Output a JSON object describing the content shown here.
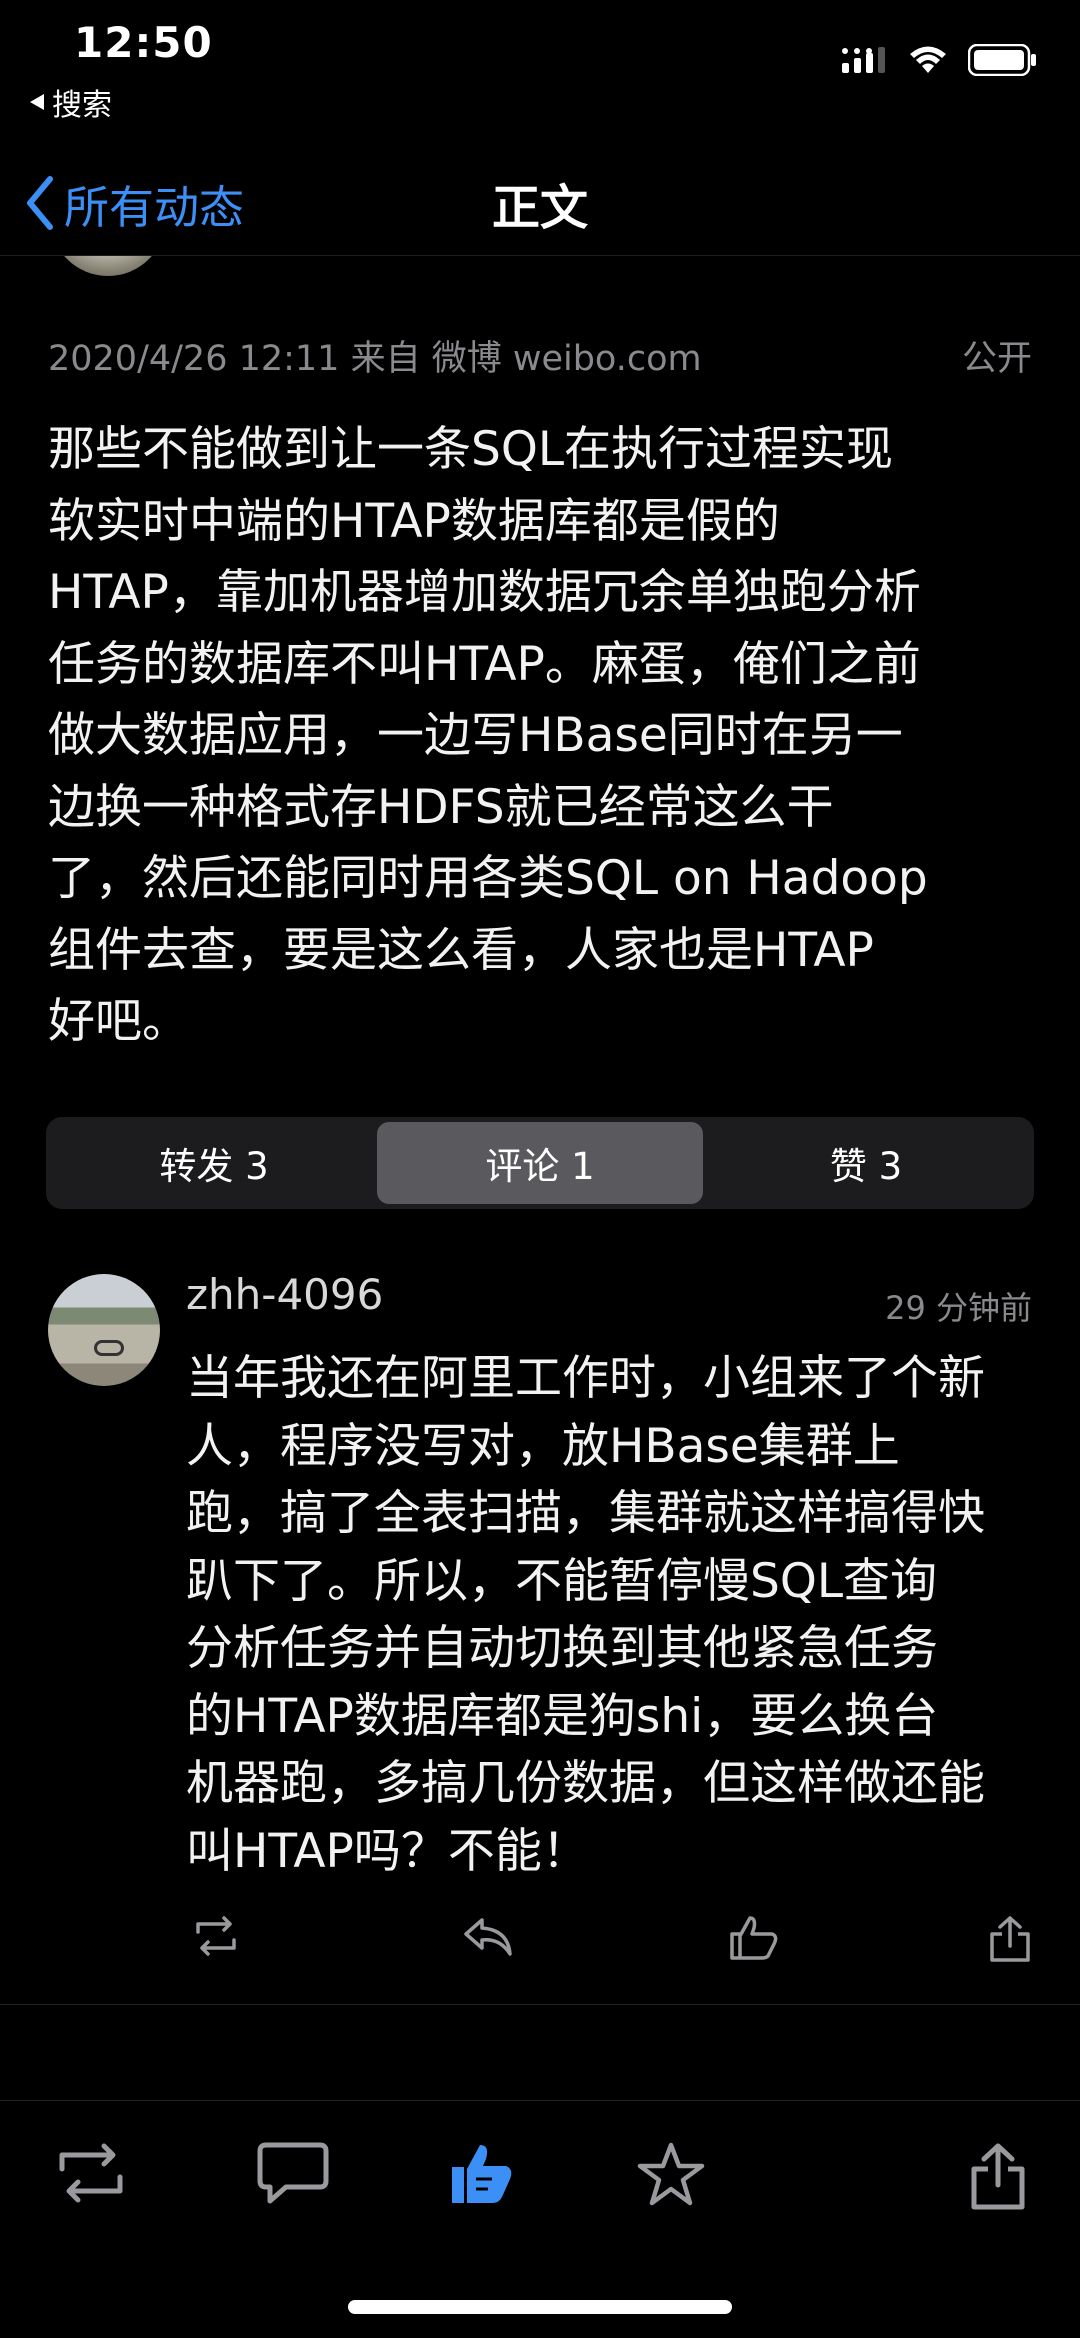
{
  "status": {
    "time": "12:50",
    "back_app": "搜索"
  },
  "nav": {
    "back_label": "所有动态",
    "title": "正文"
  },
  "post": {
    "meta_left": "2020/4/26 12:11 来自 微博 weibo.com",
    "visibility": "公开",
    "body": "那些不能做到让一条SQL在执行过程实现\n软实时中端的HTAP数据库都是假的\nHTAP，靠加机器增加数据冗余单独跑分析\n任务的数据库不叫HTAP。麻蛋，俺们之前\n做大数据应用，一边写HBase同时在另一\n边换一种格式存HDFS就已经常这么干\n了，然后还能同时用各类SQL on Hadoop\n组件去查，要是这么看，人家也是HTAP\n好吧。"
  },
  "tabs": [
    {
      "label": "转发 3",
      "active": false
    },
    {
      "label": "评论 1",
      "active": true
    },
    {
      "label": "赞 3",
      "active": false
    }
  ],
  "comment": {
    "user": "zhh-4096",
    "time": "29 分钟前",
    "text": "当年我还在阿里工作时，小组来了个新\n人，程序没写对，放HBase集群上\n跑，搞了全表扫描，集群就这样搞得快\n趴下了。所以，不能暂停慢SQL查询\n分析任务并自动切换到其他紧急任务\n的HTAP数据库都是狗shi，要么换台\n机器跑，多搞几份数据，但这样做还能\n叫HTAP吗？不能！"
  },
  "icons": {
    "comment_actions": [
      "repost-icon",
      "reply-icon",
      "like-icon",
      "share-icon"
    ],
    "bottom_bar": [
      "repost-icon",
      "comment-icon",
      "like-filled-icon",
      "favorite-icon",
      "share-icon"
    ]
  },
  "colors": {
    "accent": "#3b8ff5",
    "background": "#000000"
  }
}
